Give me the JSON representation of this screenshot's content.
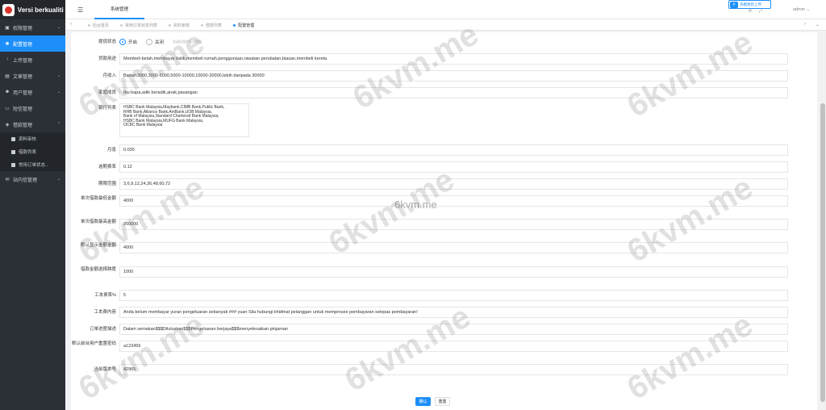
{
  "brand": {
    "title": "Versi berkualiti"
  },
  "sidebar": {
    "items": [
      {
        "label": "权限管理",
        "icon": "lock-icon",
        "caret": "⌄"
      },
      {
        "label": "配置管理",
        "icon": "gear-icon",
        "caret": ""
      },
      {
        "label": "上传管理",
        "icon": "upload-icon",
        "caret": ""
      },
      {
        "label": "文章管理",
        "icon": "file-icon",
        "caret": "⌄"
      },
      {
        "label": "用户管理",
        "icon": "user-icon",
        "caret": "⌄"
      },
      {
        "label": "短信管理",
        "icon": "sms-icon",
        "caret": ""
      },
      {
        "label": "借款管理",
        "icon": "money-icon",
        "caret": "⌃"
      }
    ],
    "subitems": [
      {
        "label": "资料审核"
      },
      {
        "label": "借款列表"
      },
      {
        "label": "常用订单状态..."
      }
    ],
    "after": {
      "label": "站内信管理",
      "icon": "mail-icon",
      "caret": "⌄"
    }
  },
  "topbar": {
    "menu_icon": "hamburger-icon",
    "tab_label": "系统管理",
    "upload_label": "热模更新上传",
    "admin_label": "admin ⌄"
  },
  "tabs": [
    {
      "label": "后台首页",
      "active": false
    },
    {
      "label": "常用订单状态列表",
      "active": false
    },
    {
      "label": "资料审核",
      "active": false
    },
    {
      "label": "借款列表",
      "active": false
    },
    {
      "label": "配置管理",
      "active": true
    }
  ],
  "form": {
    "withdraw_status": {
      "label": "提现状态",
      "on": "开启",
      "off": "关闭",
      "hint": "关闭后用户无法提现"
    },
    "loan_purpose": {
      "label": "贷款用途",
      "value": "Membeli-belah,membayar balik,membeli rumah,penggunaan,rawatan perubatan,biasan,membeli kereta"
    },
    "monthly_income": {
      "label": "月收入",
      "value": "Bawah3000,3000-5000,5000-10000,10000-30000,lebih daripada 30000"
    },
    "family": {
      "label": "家庭成员",
      "value": "Ibu bapa,adik beradik,anak,pasangan"
    },
    "banks": {
      "label": "银行列表",
      "value": "HSBC Bank Malaysia,Maybank,CIMB Bank,Public Bank,\nRHB Bank,Alliance Bank,AmBank,UOB Malaysia,\nBank of Malaysia,Standard Chartered Bank Malaysia,\nHSBC Bank Malaysia,MUFG Bank Malaysia,\nOCBC Bank Malaysia"
    },
    "monthly_rate": {
      "label": "月息",
      "value": "0.035"
    },
    "overdue_rate": {
      "label": "逾期费率",
      "value": "0.12"
    },
    "period_range": {
      "label": "期限范围",
      "value": "3,6,9,12,24,36,48,60,72"
    },
    "min_loan": {
      "label": "单次借款最低金额",
      "value": "4000"
    },
    "max_loan": {
      "label": "单次借款最高金额",
      "value": "250000"
    },
    "default_amount": {
      "label": "默认显示金额金额",
      "value": "4000"
    },
    "loan_step": {
      "label": "借款金额选择跨度",
      "value": "1000"
    },
    "fee_rate": {
      "label": "工本费率%",
      "value": "5"
    },
    "fee_content": {
      "label": "工本费内容",
      "value": "Anda belum membayar yuran pengeluaran sebanyak ### yuan Sila hubungi khidmat pelanggan untuk memproses pembayaran selepas pembayaran!"
    },
    "order_progress": {
      "label": "订单进度描述",
      "value": "Dalam semakan$$$Diluluskan$$$Pengeluaran berjaya$$$menyelesaikan pinjaman"
    },
    "default_password": {
      "label": "默认前台用户重置密码",
      "value": "a123456"
    },
    "current_version": {
      "label": "当前版本号",
      "value": "42965"
    }
  },
  "buttons": {
    "confirm": "确认",
    "reset": "重置"
  },
  "watermark": {
    "text": "6kvm.me"
  }
}
